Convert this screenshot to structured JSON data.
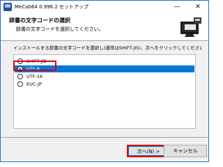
{
  "window": {
    "title": "MeCab64 0.996.2 セットアップ",
    "minimize_symbol": "—",
    "close_symbol": "✕"
  },
  "header": {
    "title": "辞書の文字コードの選択",
    "subtitle": "辞書の文字コードを選択してください。",
    "logo_icon": "computer-installer-icon"
  },
  "instruction": "インストールする辞書の文字コードを選択し(通常はSHIFT-JIS)、次へをクリックしてください。",
  "encoding_options": [
    {
      "label": "SHIFT-JIS",
      "checked": false
    },
    {
      "label": "UTF-8",
      "checked": true
    },
    {
      "label": "UTF-16",
      "checked": false
    },
    {
      "label": "EUC-JP",
      "checked": false
    }
  ],
  "buttons": {
    "next": "次へ(N) >",
    "cancel": "キャンセル"
  },
  "colors": {
    "selection": "#0078d7",
    "highlight_annotation": "#e00000",
    "window_border": "#2b6cc4"
  }
}
